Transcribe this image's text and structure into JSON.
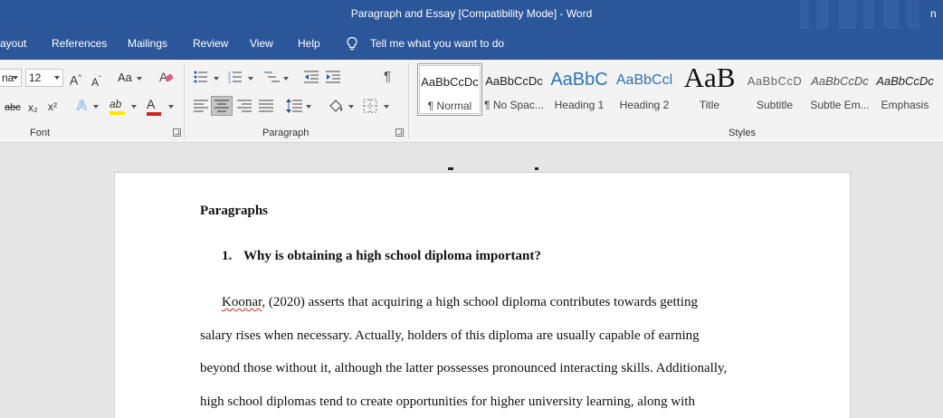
{
  "window": {
    "title": "Paragraph and Essay [Compatibility Mode]  -  Word",
    "tr_glyph": "n"
  },
  "tabs": [
    {
      "label": "ayout"
    },
    {
      "label": "References"
    },
    {
      "label": "Mailings"
    },
    {
      "label": "Review"
    },
    {
      "label": "View"
    },
    {
      "label": "Help"
    }
  ],
  "tell_me": {
    "label": "Tell me what you want to do",
    "icon": "lightbulb-icon"
  },
  "ribbon": {
    "font": {
      "group_label": "Font",
      "font_name": "na",
      "font_size": "12",
      "change_case": "Aa",
      "strikethrough": "abc",
      "subscript": "x₂",
      "superscript": "x²",
      "text_effects": "A",
      "font_color_letter": "A",
      "clear_format_letter": "A",
      "grow_letter": "A",
      "shrink_letter": "A",
      "highlight_letters": "ab",
      "highlight_color": "#ffe600",
      "font_color": "#d12222"
    },
    "paragraph": {
      "group_label": "Paragraph",
      "pilcrow": "¶"
    },
    "styles": {
      "group_label": "Styles",
      "items": [
        {
          "preview": "AaBbCcDc",
          "name": "¶ Normal",
          "selected": true
        },
        {
          "preview": "AaBbCcDc",
          "name": "¶ No Spac..."
        },
        {
          "preview": "AaBbC",
          "name": "Heading 1"
        },
        {
          "preview": "AaBbCcl",
          "name": "Heading 2"
        },
        {
          "preview": "AaB",
          "name": "Title"
        },
        {
          "preview": "AaBbCcD",
          "name": "Subtitle"
        },
        {
          "preview": "AaBbCcDc",
          "name": "Subtle Em..."
        },
        {
          "preview": "AaBbCcDc",
          "name": "Emphasis"
        }
      ]
    }
  },
  "document": {
    "section_heading": "Paragraphs",
    "question_number": "1.",
    "question_text": "Why is obtaining a high school diploma important?",
    "para_first_word": "Koonar",
    "para_line1_rest": ", (2020) asserts that acquiring a high school diploma contributes towards getting",
    "para_line2": "salary rises when necessary. Actually, holders of this diploma are usually capable of earning",
    "para_line3": "beyond those without it, although the latter possesses pronounced interacting skills. Additionally,",
    "para_line4": "high school diplomas tend to create opportunities for higher university learning, along with"
  }
}
